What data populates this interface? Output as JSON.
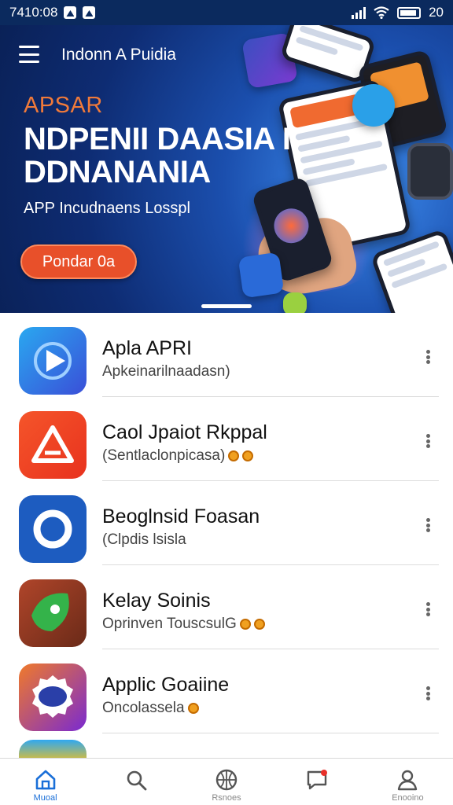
{
  "status_bar": {
    "time": "7410:08",
    "battery_label": "20"
  },
  "header": {
    "title": "Indonn A Puidia"
  },
  "hero": {
    "kicker": "APSAR",
    "headline": "NDPENII DAASIA I DDNANANIA",
    "subtitle": "APP Incudnaens Losspl",
    "cta_label": "Pondar 0a"
  },
  "apps": [
    {
      "name": "Apla APRI",
      "subtitle": "Apkeinarilnaadasn)",
      "icon": "play-icon",
      "badge": false
    },
    {
      "name": "Caol Jpaiot Rkppal",
      "subtitle": "(Sentlaclonpicasa)",
      "icon": "triangle-logo-icon",
      "badge": true
    },
    {
      "name": "Beoglnsid Foasan",
      "subtitle": "(Clpdis lsisla",
      "icon": "ring-icon",
      "badge": false
    },
    {
      "name": "Kelay Soinis",
      "subtitle": "Oprinven TouscsulG",
      "icon": "leaf-icon",
      "badge": true
    },
    {
      "name": "Applic Goaiine",
      "subtitle": "Oncolassela",
      "icon": "badge-logo-icon",
      "badge": true
    }
  ],
  "bottom_nav": [
    {
      "label": "Muoal",
      "icon": "home-icon",
      "active": true
    },
    {
      "label": "",
      "icon": "search-icon",
      "active": false
    },
    {
      "label": "Rsnoes",
      "icon": "globe-icon",
      "active": false
    },
    {
      "label": "",
      "icon": "message-icon",
      "active": false
    },
    {
      "label": "Enooino",
      "icon": "profile-icon",
      "active": false
    }
  ],
  "colors": {
    "status_bar": "#0b2a5e",
    "hero_dark": "#0e2c73",
    "accent_orange": "#e8502a",
    "nav_active": "#1a6fd8"
  }
}
